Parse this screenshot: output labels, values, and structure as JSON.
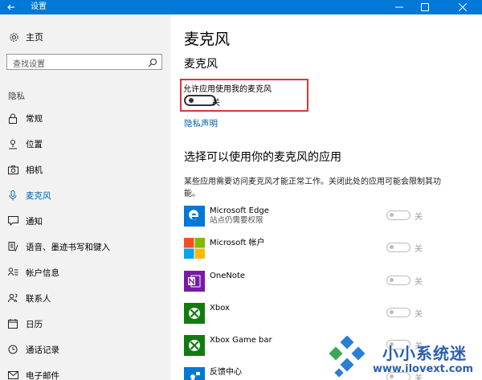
{
  "window": {
    "title": "设置"
  },
  "sidebar": {
    "home_label": "主页",
    "search_placeholder": "查找设置",
    "section_label": "隐私",
    "items": [
      {
        "label": "常规",
        "icon": "lock-icon"
      },
      {
        "label": "位置",
        "icon": "location-icon"
      },
      {
        "label": "相机",
        "icon": "camera-icon"
      },
      {
        "label": "麦克风",
        "icon": "microphone-icon",
        "active": true
      },
      {
        "label": "通知",
        "icon": "notification-icon"
      },
      {
        "label": "语音、墨迹书写和键入",
        "icon": "speech-icon"
      },
      {
        "label": "帐户信息",
        "icon": "account-info-icon"
      },
      {
        "label": "联系人",
        "icon": "contacts-icon"
      },
      {
        "label": "日历",
        "icon": "calendar-icon"
      },
      {
        "label": "通话记录",
        "icon": "call-history-icon"
      },
      {
        "label": "电子邮件",
        "icon": "email-icon"
      }
    ]
  },
  "main": {
    "title": "麦克风",
    "subtitle": "麦克风",
    "allow_label": "允许应用使用我的麦克风",
    "allow_state": "关",
    "privacy_link": "隐私声明",
    "apps_heading": "选择可以使用你的麦克风的应用",
    "apps_description": "某些应用需要访问麦克风才能正常工作。关闭此处的应用可能会限制其功能。",
    "apps": [
      {
        "name": "Microsoft Edge",
        "sub": "站点仍需要权限",
        "state": "关",
        "icon": "edge-icon",
        "color": "#0078d7"
      },
      {
        "name": "Microsoft 帐户",
        "sub": "",
        "state": "关",
        "icon": "microsoft-logo-icon",
        "color": "#ffffff"
      },
      {
        "name": "OneNote",
        "sub": "",
        "state": "关",
        "icon": "onenote-icon",
        "color": "#7719aa"
      },
      {
        "name": "Xbox",
        "sub": "",
        "state": "关",
        "icon": "xbox-icon",
        "color": "#107c10"
      },
      {
        "name": "Xbox Game bar",
        "sub": "",
        "state": "关",
        "icon": "xbox-gamebar-icon",
        "color": "#107c10"
      },
      {
        "name": "反馈中心",
        "sub": "",
        "state": "关",
        "icon": "feedback-hub-icon",
        "color": "#0078d7"
      }
    ]
  },
  "watermark": {
    "title": "小小系统迷",
    "url": "www.ilovext.com"
  },
  "colors": {
    "accent": "#0078d7",
    "link": "#0063b1",
    "highlight_border": "#d9363e",
    "sidebar_bg": "#f2f2f2"
  }
}
